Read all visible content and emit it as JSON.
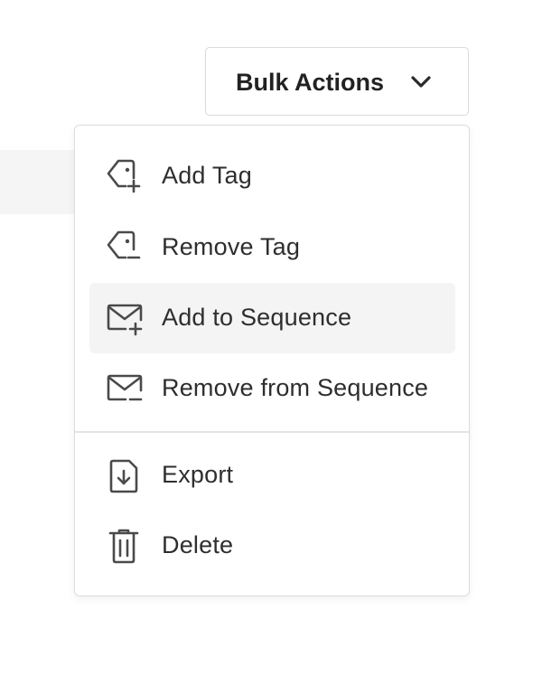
{
  "bulk_actions": {
    "label": "Bulk Actions",
    "icon": "chevron-down-icon"
  },
  "menu": {
    "items": [
      {
        "label": "Add Tag",
        "icon": "tag-add-icon"
      },
      {
        "label": "Remove Tag",
        "icon": "tag-remove-icon"
      },
      {
        "label": "Add to Sequence",
        "icon": "mail-add-icon",
        "highlighted": true
      },
      {
        "label": "Remove from Sequence",
        "icon": "mail-remove-icon"
      },
      {
        "label": "Export",
        "icon": "file-download-icon"
      },
      {
        "label": "Delete",
        "icon": "trash-icon"
      }
    ]
  },
  "colors": {
    "icon": "#4a4a4a",
    "text": "#2e2e2e",
    "border": "#dcdcdc",
    "highlight": "#f4f4f4"
  }
}
